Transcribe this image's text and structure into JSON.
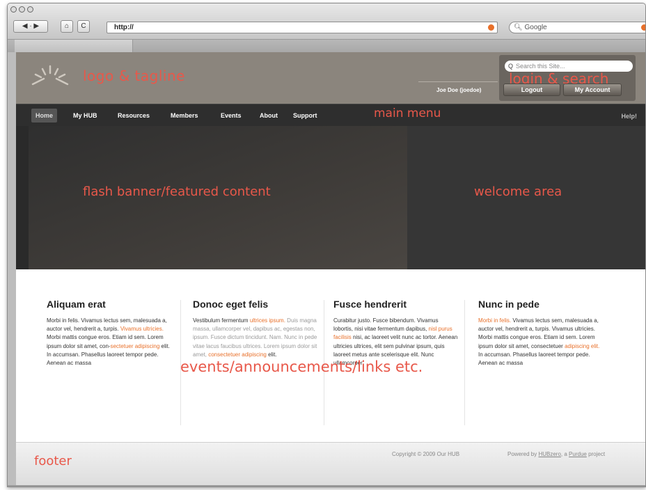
{
  "browser": {
    "url": "http://",
    "search_placeholder": "Google",
    "back_label": "◀ · ▶",
    "home_label": "⌂",
    "reload_label": "C"
  },
  "site": {
    "header": {
      "logo_annotation": "logo & tagline",
      "search_placeholder": "Search this Site...",
      "login_annotation": "login & search",
      "user": "Joe Doe (joedoe)",
      "logout": "Logout",
      "account": "My Account"
    },
    "menu": {
      "items": [
        "Home",
        "My HUB",
        "Resources",
        "Members",
        "Events",
        "About",
        "Support"
      ],
      "annotation": "main menu",
      "help": "Help!"
    },
    "banner": {
      "featured_annotation": "flash banner/featured content",
      "welcome_annotation": "welcome area"
    },
    "columns": [
      {
        "title": "Aliquam erat",
        "text_a": "Morbi in felis. Vivamus lectus sem, malesuada a, auctor vel, hendrerit a, turpis. ",
        "link_a": "Vivamus ultricies.",
        "text_b": " Morbi mattis congue eros. Etiam id sem. Lorem ipsum dolor sit amet, con-",
        "link_b": "sectetuer adipiscing",
        "text_c": " elit. In accumsan. Phasellus laoreet tempor pede. Aenean ac massa"
      },
      {
        "title": "Donoc eget felis",
        "text_a": "Vestibulum fermentum ",
        "link_a": "ultrices ipsum.",
        "text_b": " Duis magna massa, ullamcorper vel, dapibus ac, egestas non, ipsum. Fusce dictum tincidunt. Nam. Nunc in pede vitae lacus faucibus ultrices. Lorem ipsum dolor sit amet, ",
        "link_b": "consectetuer adipiscing",
        "text_c": " elit."
      },
      {
        "title": "Fusce hendrerit",
        "text_a": "Curabitur justo. Fusce bibendum. Vivamus lobortis, nisi vitae fermentum dapibus, ",
        "link_a": "nisl purus facilisis",
        "text_b": " nisi, ac laoreet velit nunc ac tortor. Aenean ultricies ultrices, elit sem pulvinar ipsum, quis laoreet metus ante scelerisque elit. Nunc ullamcorper",
        "link_b": "",
        "text_c": ""
      },
      {
        "title": "Nunc in pede",
        "text_a": "",
        "link_a": "Morbi in felis.",
        "text_b": " Vivamus lectus sem, malesuada a, auctor vel, hendrerit a, turpis. Vivamus ultricies. Morbi mattis congue eros. Etiam id sem. Lorem ipsum dolor sit amet, consectetuer ",
        "link_b": "adipiscing elit.",
        "text_c": " In accumsan. Phasellus laoreet tempor pede. Aenean ac massa"
      }
    ],
    "events_annotation": "events/announcements/links etc.",
    "footer": {
      "annotation": "footer",
      "copyright": "Copyright © 2009 Our HUB",
      "powered_prefix": "Powered by ",
      "powered_link1": "HUBzero",
      "powered_mid": ", a ",
      "powered_link2": "Purdue",
      "powered_suffix": " project"
    }
  },
  "colors": {
    "annotation": "#e8584a",
    "link": "#e8702a",
    "header_bg": "#8b857d",
    "menu_bg": "#2e2e2e"
  }
}
